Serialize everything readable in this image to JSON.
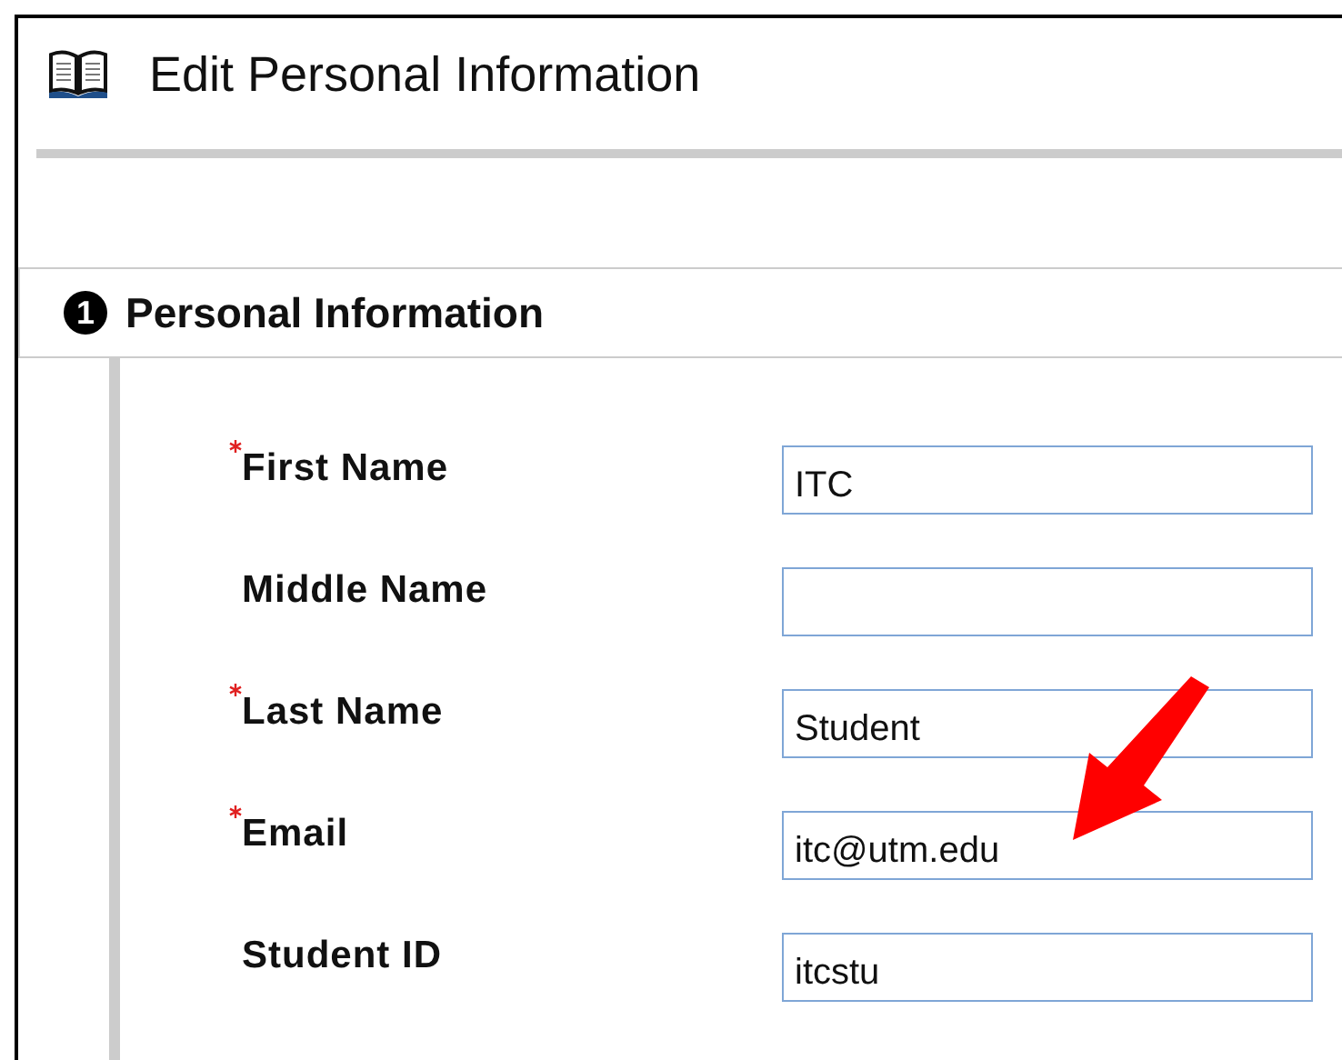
{
  "page": {
    "title": "Edit Personal Information"
  },
  "section": {
    "number": "1",
    "title": "Personal Information"
  },
  "fields": [
    {
      "label": "First Name",
      "required": true,
      "value": "ITC"
    },
    {
      "label": "Middle Name",
      "required": false
    },
    {
      "label": "Last Name",
      "required": true,
      "value": "Student"
    },
    {
      "label": "Email",
      "required": true,
      "value": "itc@utm.edu"
    },
    {
      "label": "Student ID",
      "required": false,
      "value": "itcstu"
    }
  ]
}
